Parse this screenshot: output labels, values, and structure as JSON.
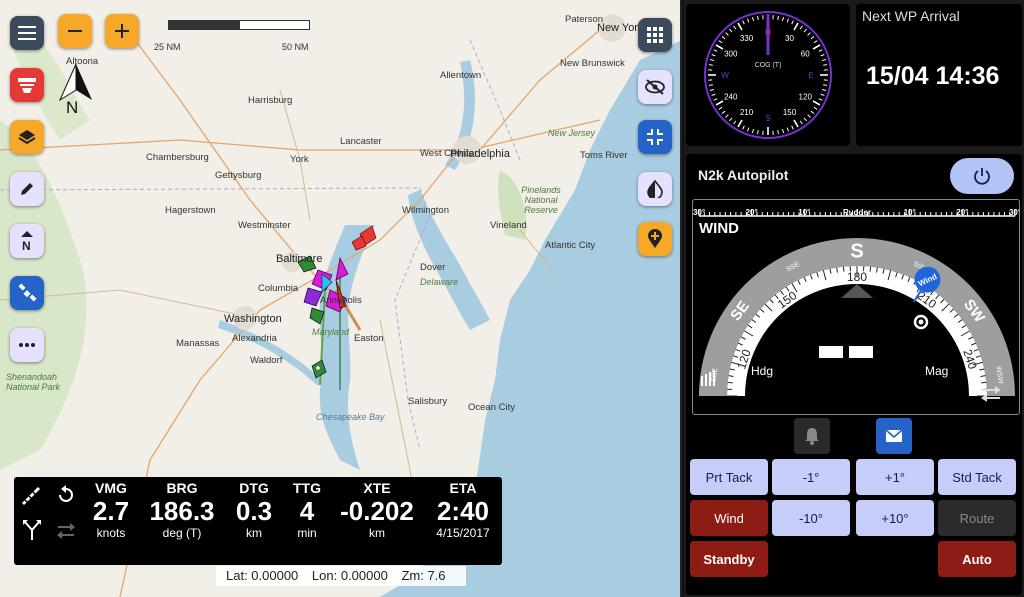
{
  "map": {
    "scale": {
      "left_label": "25 NM",
      "right_label": "50 NM"
    },
    "north_label": "N",
    "labels": {
      "new_york": "New York",
      "paterson": "Paterson",
      "new_brunswick": "New Brunswick",
      "allentown": "Allentown",
      "philadelphia": "Philadelphia",
      "harrisburg": "Harrisburg",
      "lancaster": "Lancaster",
      "west_chester": "West Chester",
      "york": "York",
      "chambersburg": "Chambersburg",
      "gettysburg": "Gettysburg",
      "hagerstown": "Hagerstown",
      "westminster": "Westminster",
      "baltimore": "Baltimore",
      "columbia": "Columbia",
      "wilmington": "Wilmington",
      "washington": "Washington",
      "alexandria": "Alexandria",
      "annapolis": "Annapolis",
      "manassas": "Manassas",
      "waldorf": "Waldorf",
      "dover": "Dover",
      "easton": "Easton",
      "salisbury": "Salisbury",
      "ocean_city": "Ocean City",
      "atlantic_city": "Atlantic City",
      "vineland": "Vineland",
      "toms_river": "Toms River",
      "new_jersey": "New Jersey",
      "maryland": "Maryland",
      "delaware": "Delaware",
      "pinelands": "Pinelands National Reserve",
      "chesapeake": "Chesapeake Bay",
      "altoona": "Altoona",
      "shenandoah": "Shenandoah National Park"
    }
  },
  "databar": {
    "items": [
      {
        "title": "VMG",
        "value": "2.7",
        "unit": "knots"
      },
      {
        "title": "BRG",
        "value": "186.3",
        "unit": "deg (T)"
      },
      {
        "title": "DTG",
        "value": "0.3",
        "unit": "km"
      },
      {
        "title": "TTG",
        "value": "4",
        "unit": "min"
      },
      {
        "title": "XTE",
        "value": "-0.202",
        "unit": "km"
      },
      {
        "title": "ETA",
        "value": "2:40",
        "unit": "4/15/2017"
      }
    ]
  },
  "coords": {
    "lat": "Lat: 0.00000",
    "lon": "Lon: 0.00000",
    "zoom": "Zm: 7.6"
  },
  "compass": {
    "label": "COG (T)",
    "ticks": [
      "N",
      "30",
      "60",
      "E",
      "120",
      "150",
      "S",
      "210",
      "240",
      "W",
      "300",
      "330"
    ],
    "heading_deg": 0
  },
  "next_wp": {
    "title": "Next WP Arrival",
    "value": "15/04 14:36"
  },
  "autopilot": {
    "title": "N2k Autopilot",
    "rudder": {
      "label": "Rudder",
      "ticks": [
        "30°",
        "20°",
        "10°",
        "Rudder",
        "10°",
        "20°",
        "30°"
      ]
    },
    "mode": "WIND",
    "dial_labels": [
      "ESE",
      "120",
      "SE",
      "150",
      "SSE",
      "S",
      "180",
      "SSW",
      "210",
      "SW",
      "240",
      "WSW"
    ],
    "wind_marker": "Wind",
    "hdg_label": "Hdg",
    "mag_label": "Mag",
    "buttons": {
      "prt_tack": "Prt Tack",
      "minus1": "-1°",
      "plus1": "+1°",
      "std_tack": "Std Tack",
      "wind": "Wind",
      "minus10": "-10°",
      "plus10": "+10°",
      "route": "Route",
      "standby": "Standby",
      "auto": "Auto"
    }
  },
  "colors": {
    "accent_orange": "#f6a829",
    "accent_blue": "#2563c9",
    "lavender": "#c5cdf8",
    "autopilot_red": "#8d1c14",
    "compass_purple": "#7a2fd1"
  }
}
